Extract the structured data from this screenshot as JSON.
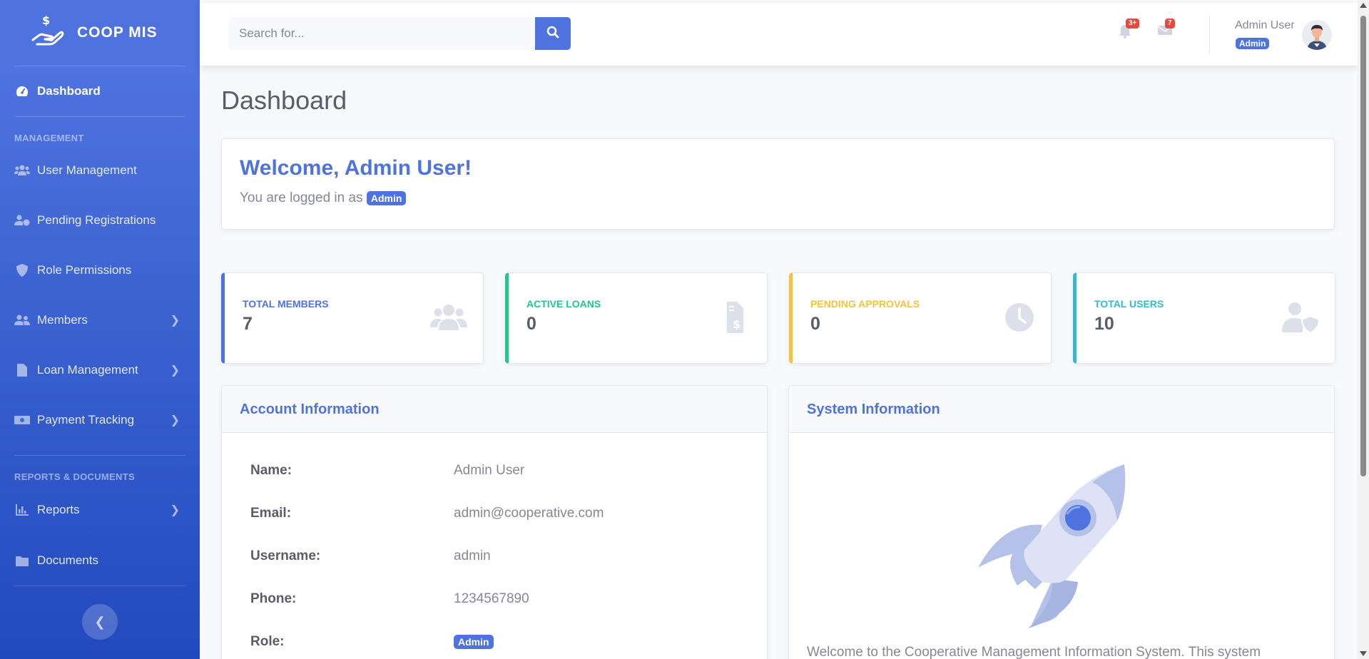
{
  "brand": {
    "name": "COOP MIS",
    "icon": "hand-holding-dollar-icon"
  },
  "sidebar": {
    "dashboard": "Dashboard",
    "heading_management": "MANAGEMENT",
    "heading_reports": "REPORTS & DOCUMENTS",
    "items": [
      {
        "label": "User Management",
        "icon": "users-cog-icon"
      },
      {
        "label": "Pending Registrations",
        "icon": "user-clock-icon"
      },
      {
        "label": "Role Permissions",
        "icon": "shield-icon"
      },
      {
        "label": "Members",
        "icon": "users-icon",
        "expandable": true
      },
      {
        "label": "Loan Management",
        "icon": "file-invoice-icon",
        "expandable": true
      },
      {
        "label": "Payment Tracking",
        "icon": "money-bill-icon",
        "expandable": true
      },
      {
        "label": "Reports",
        "icon": "chart-bar-icon",
        "expandable": true
      },
      {
        "label": "Documents",
        "icon": "folder-icon"
      }
    ],
    "toggle_icon": "chevron-left-icon"
  },
  "topbar": {
    "search_placeholder": "Search for...",
    "alerts_count": "3+",
    "messages_count": "7",
    "user_name": "Admin User",
    "user_role": "Admin"
  },
  "page": {
    "title": "Dashboard"
  },
  "welcome": {
    "title": "Welcome, Admin User!",
    "text": "You are logged in as",
    "role": "Admin"
  },
  "stats": [
    {
      "label": "TOTAL MEMBERS",
      "value": "7",
      "color": "#4e73df",
      "icon": "users-icon"
    },
    {
      "label": "ACTIVE LOANS",
      "value": "0",
      "color": "#1cc88a",
      "icon": "file-invoice-dollar-icon"
    },
    {
      "label": "PENDING APPROVALS",
      "value": "0",
      "color": "#f6c23e",
      "icon": "clock-icon"
    },
    {
      "label": "TOTAL USERS",
      "value": "10",
      "color": "#36b9cc",
      "icon": "user-shield-icon"
    }
  ],
  "account": {
    "title": "Account Information",
    "rows": [
      {
        "key": "Name:",
        "value": "Admin User"
      },
      {
        "key": "Email:",
        "value": "admin@cooperative.com"
      },
      {
        "key": "Username:",
        "value": "admin"
      },
      {
        "key": "Phone:",
        "value": "1234567890"
      },
      {
        "key": "Role:",
        "value": "Admin"
      }
    ]
  },
  "system": {
    "title": "System Information",
    "text": "Welcome to the Cooperative Management Information System. This system",
    "illustration": "rocket-illustration"
  }
}
